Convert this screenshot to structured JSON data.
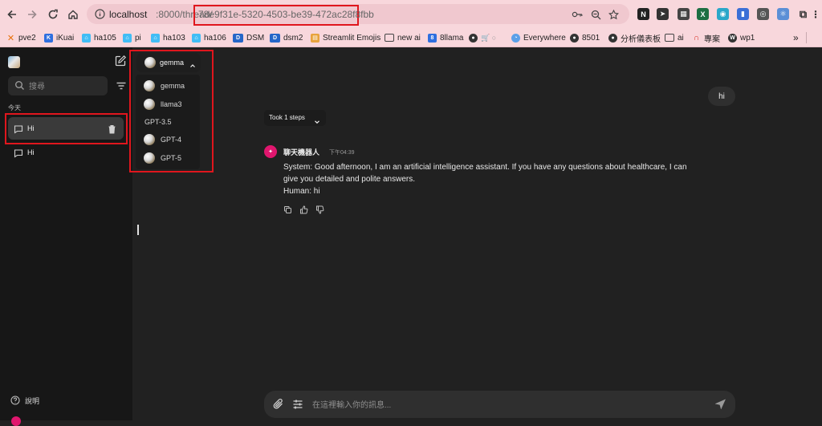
{
  "browser": {
    "url_host": "localhost",
    "url_path": ":8000/thread/",
    "url_id": "78e9f31e-5320-4503-be39-472ac28f8fbb"
  },
  "bookmarks": [
    {
      "label": "pve2",
      "color": "#e8710a"
    },
    {
      "label": "iKuai",
      "color": "#2f6fdf"
    },
    {
      "label": "ha105",
      "color": "#41bdf5"
    },
    {
      "label": "pi",
      "color": "#41bdf5"
    },
    {
      "label": "ha103",
      "color": "#41bdf5"
    },
    {
      "label": "ha106",
      "color": "#41bdf5"
    },
    {
      "label": "DSM",
      "color": "#2566c8"
    },
    {
      "label": "dsm2",
      "color": "#2566c8"
    },
    {
      "label": "Streamlit Emojis",
      "color": "#e8a33d"
    },
    {
      "label": "new ai",
      "color": "folder"
    },
    {
      "label": "8llama",
      "color": "#2f6fdf"
    },
    {
      "label": "Everywhere",
      "color": "#5aa0e8"
    },
    {
      "label": "8501",
      "color": "#333333"
    },
    {
      "label": "分析儀表板",
      "color": "#333333"
    },
    {
      "label": "ai",
      "color": "folder"
    },
    {
      "label": "專案",
      "color": "#d93025"
    },
    {
      "label": "wp1",
      "color": "#333333"
    }
  ],
  "sidebar": {
    "search_placeholder": "搜尋",
    "section_today": "今天",
    "threads": [
      {
        "label": "Hi",
        "active": true
      },
      {
        "label": "Hi",
        "active": false
      }
    ],
    "help_label": "說明"
  },
  "model": {
    "selected": "gemma",
    "options": [
      {
        "label": "gemma",
        "icon": true
      },
      {
        "label": "llama3",
        "icon": true
      },
      {
        "label": "GPT-3.5",
        "icon": false
      },
      {
        "label": "GPT-4",
        "icon": true
      },
      {
        "label": "GPT-5",
        "icon": true
      }
    ]
  },
  "chat": {
    "user_message": "hi",
    "steps_label": "Took 1 steps",
    "bot_name": "聊天機器人",
    "bot_time": "下午04:39",
    "bot_lines": [
      "System: Good afternoon, I am an artificial intelligence assistant. If you have any questions about healthcare, I can",
      "give you detailed and polite answers.",
      "Human: hi"
    ]
  },
  "composer": {
    "placeholder": "在這裡輸入你的訊息..."
  },
  "colors": {
    "accent": "#e0166e",
    "highlight": "#e0161d",
    "browser_bar": "#f8d7dc"
  }
}
